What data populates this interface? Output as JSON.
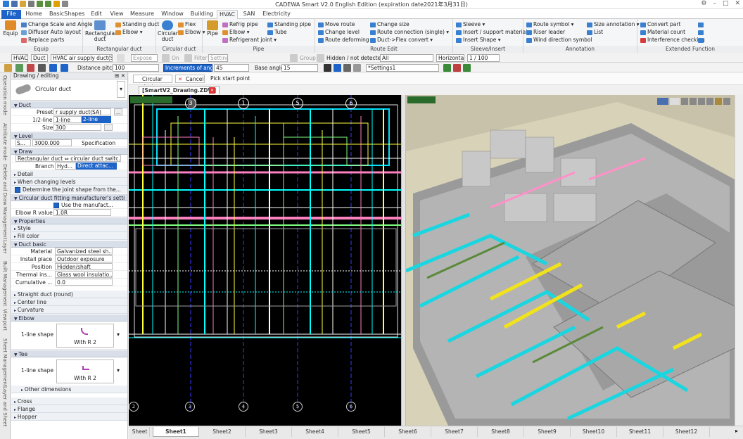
{
  "app": {
    "title": "CADEWA Smart V2.0 English Edition  (expiration date2021年3月31日)"
  },
  "menu_tabs": [
    "File",
    "Home",
    "BasicShapes",
    "Edit",
    "View",
    "Measure",
    "Window",
    "Building",
    "HVAC",
    "SAN",
    "Electricity"
  ],
  "active_tab": "HVAC",
  "ribbon": {
    "equip": {
      "label": "Equip",
      "big": "Equip",
      "items": [
        "Change Scale and Angle",
        "Diffuser Auto layout",
        "Replace parts"
      ]
    },
    "rect_duct": {
      "label": "Rectangular duct",
      "big": "Rectangular duct",
      "items": [
        "Standing duct",
        "Elbow ▾"
      ]
    },
    "circ_duct": {
      "label": "Circular duct",
      "big": "Circular duct",
      "items": [
        "Flex",
        "Elbow ▾"
      ]
    },
    "pipe": {
      "label": "Pipe",
      "big": "Pipe",
      "items": [
        "Refrig pipe",
        "Elbow ▾",
        "Refrigerant joint ▾",
        "Standing pipe",
        "Tube"
      ]
    },
    "route_edit": {
      "label": "Route Edit",
      "items": [
        "Move route",
        "Change level",
        "Route deforming ▾",
        "Change size",
        "Route connection (single) ▾",
        "Duct->Flex convert ▾"
      ]
    },
    "sleeve": {
      "label": "Sleeve/Insert",
      "items": [
        "Sleeve ▾",
        "Insert / support material",
        "Insert Shape ▾"
      ]
    },
    "annotation": {
      "label": "Annotation",
      "items": [
        "Route symbol ▾",
        "Riser leader",
        "Wind direction symbol",
        "Size annotation ▾",
        "List"
      ]
    },
    "extended": {
      "label": "Extended Function",
      "items": [
        "Convert part",
        "Material count",
        "Interference checking"
      ]
    }
  },
  "toolbar1": {
    "system": "HVAC ▾",
    "kind": "Duct ▾",
    "name": "HVAC air supply duct(SA)",
    "expose": "Expose",
    "on": "On",
    "filter": "Filter",
    "setting": "Setting",
    "group": "Group",
    "hidden": "Hidden / not detected",
    "all": "All",
    "horizontal": "Horizontal",
    "scale": "1 / 100"
  },
  "toolbar2": {
    "pitch_label": "Distance pitch",
    "pitch": "100",
    "angle_label": "Increments of angle",
    "angle": "45",
    "base_label": "Base angle",
    "base": "15",
    "settings": "*Settings1"
  },
  "command": {
    "name": "Circular duct",
    "cancel": "Cancel",
    "prompt": "Pick start point"
  },
  "document_tab": "[SmartV2_Drawing.ZDW]",
  "panel": {
    "header": "Drawing / editing",
    "tool": "Circular duct",
    "duct": {
      "title": "Duct",
      "preset_label": "Preset",
      "preset": "r supply duct(SA)",
      "line_label": "1/2-line",
      "line1": "1-line",
      "line2": "2-line",
      "size_label": "Size",
      "size": "300"
    },
    "level": {
      "title": "Level",
      "ref": "S...",
      "value": "3000.000",
      "spec": "Specification"
    },
    "draw": {
      "title": "Draw",
      "conv": "Rectangular duct ⇔ circular duct switc...",
      "branch_label": "Branch",
      "branch1": "Hyd...",
      "branch2": "Direct attac..."
    },
    "misc": [
      "Detail",
      "When changing levels"
    ],
    "joint": "Determine the joint shape from the...",
    "fitting": {
      "title": "Circular duct fitting manufacturer's setti",
      "use": "Use the manufact...",
      "elbow_label": "Elbow R value",
      "elbow": "1.0R"
    },
    "properties": {
      "title": "Properties",
      "items": [
        "Style",
        "Fill color"
      ]
    },
    "duct_basic": {
      "title": "Duct basic",
      "rows": [
        {
          "label": "Material",
          "value": "Galvanized steel sh..."
        },
        {
          "label": "Install place",
          "value": "Outdoor exposure"
        },
        {
          "label": "Position",
          "value": "Hidden/shaft"
        },
        {
          "label": "Thermal ins...",
          "value": "Glass wool insulatio..."
        },
        {
          "label": "Cumulative ...",
          "value": "0.0"
        }
      ]
    },
    "after": [
      "Straight duct (round)",
      "Center line",
      "Curvature"
    ],
    "elbow": {
      "title": "Elbow",
      "shape_label": "1-line shape",
      "shape": "With R 2"
    },
    "tee": {
      "title": "Tee",
      "shape_label": "1-line shape",
      "shape": "With R 2",
      "other": "Other dimensions"
    },
    "tail": [
      "Cross",
      "Flange",
      "Hopper"
    ]
  },
  "vtabs": [
    "Operation mode",
    "Attribute mode",
    "Delete and Draw Management",
    "Layer",
    "Built Management",
    "Viewport",
    "Sheet Management",
    "Layer and Sheet"
  ],
  "grid_top": [
    "3",
    "1",
    "5",
    "6"
  ],
  "grid_bottom": [
    "2",
    "3",
    "4",
    "5",
    "6"
  ],
  "sheets": [
    "Sheet",
    "Sheet1",
    "Sheet2",
    "Sheet3",
    "Sheet4",
    "Sheet5",
    "Sheet6",
    "Sheet7",
    "Sheet8",
    "Sheet9",
    "Sheet10",
    "Sheet11",
    "Sheet12"
  ],
  "active_sheet": "Sheet1",
  "colors": {
    "accent": "#1e64c8",
    "cad_bg": "#000000",
    "duct_cyan": "#19d6e0",
    "duct_yellow": "#f2e21c",
    "floor": "#c8c2aa"
  }
}
